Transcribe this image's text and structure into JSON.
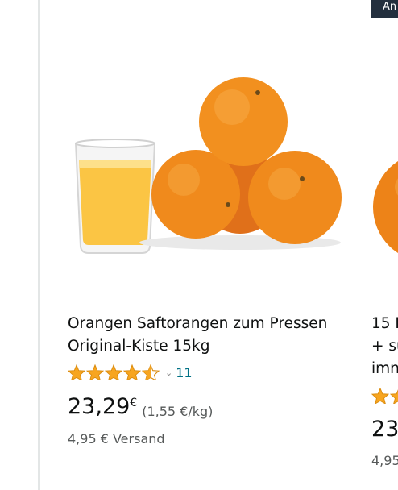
{
  "product_1": {
    "title_line1": "Orangen Saftorangen zum Pressen",
    "title_line2": "Original-Kiste 15kg",
    "rating_value": 4.5,
    "review_count": "11",
    "price_main": "23,29",
    "price_currency": "€",
    "unit_price": "(1,55 €/kg)",
    "shipping": "4,95 € Versand",
    "colors": {
      "star": "#f7a520",
      "link": "#007185",
      "orange": "#f08a1c",
      "juice": "#fbc544"
    }
  },
  "product_2": {
    "badge": "An",
    "title_line1": "15 I",
    "title_line2": "+ sü",
    "title_line3": "imn",
    "price_partial": "23",
    "shipping_partial": "4,95"
  }
}
